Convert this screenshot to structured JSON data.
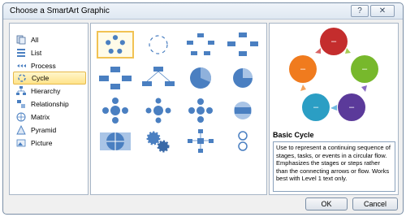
{
  "window": {
    "title": "Choose a SmartArt Graphic",
    "help": "?",
    "close": "✕"
  },
  "categories": [
    {
      "label": "All",
      "icon": "all-icon"
    },
    {
      "label": "List",
      "icon": "list-icon"
    },
    {
      "label": "Process",
      "icon": "process-icon"
    },
    {
      "label": "Cycle",
      "icon": "cycle-icon",
      "selected": true
    },
    {
      "label": "Hierarchy",
      "icon": "hierarchy-icon"
    },
    {
      "label": "Relationship",
      "icon": "relationship-icon"
    },
    {
      "label": "Matrix",
      "icon": "matrix-icon"
    },
    {
      "label": "Pyramid",
      "icon": "pyramid-icon"
    },
    {
      "label": "Picture",
      "icon": "picture-icon"
    }
  ],
  "gallery": {
    "layouts": [
      "basic-cycle",
      "text-cycle",
      "block-cycle",
      "segmented-cycle",
      "nondirectional-cycle",
      "continuous-cycle",
      "multidirectional-cycle",
      "radial-cycle",
      "basic-radial",
      "diverging-radial",
      "radial-venn",
      "cycle-matrix",
      "basic-pie",
      "gear",
      "radial-cluster",
      "cycle-arrows"
    ],
    "selected": "basic-cycle"
  },
  "preview": {
    "name": "Basic Cycle",
    "description": "Use to represent a continuing sequence of stages, tasks, or events in a circular flow. Emphasizes the stages or steps rather than the connecting arrows or flow. Works best with Level 1 text only.",
    "colors": [
      "#c42d2d",
      "#77b82c",
      "#5b3a9a",
      "#2b9ec4",
      "#f07b1e"
    ]
  },
  "buttons": {
    "ok": "OK",
    "cancel": "Cancel"
  }
}
